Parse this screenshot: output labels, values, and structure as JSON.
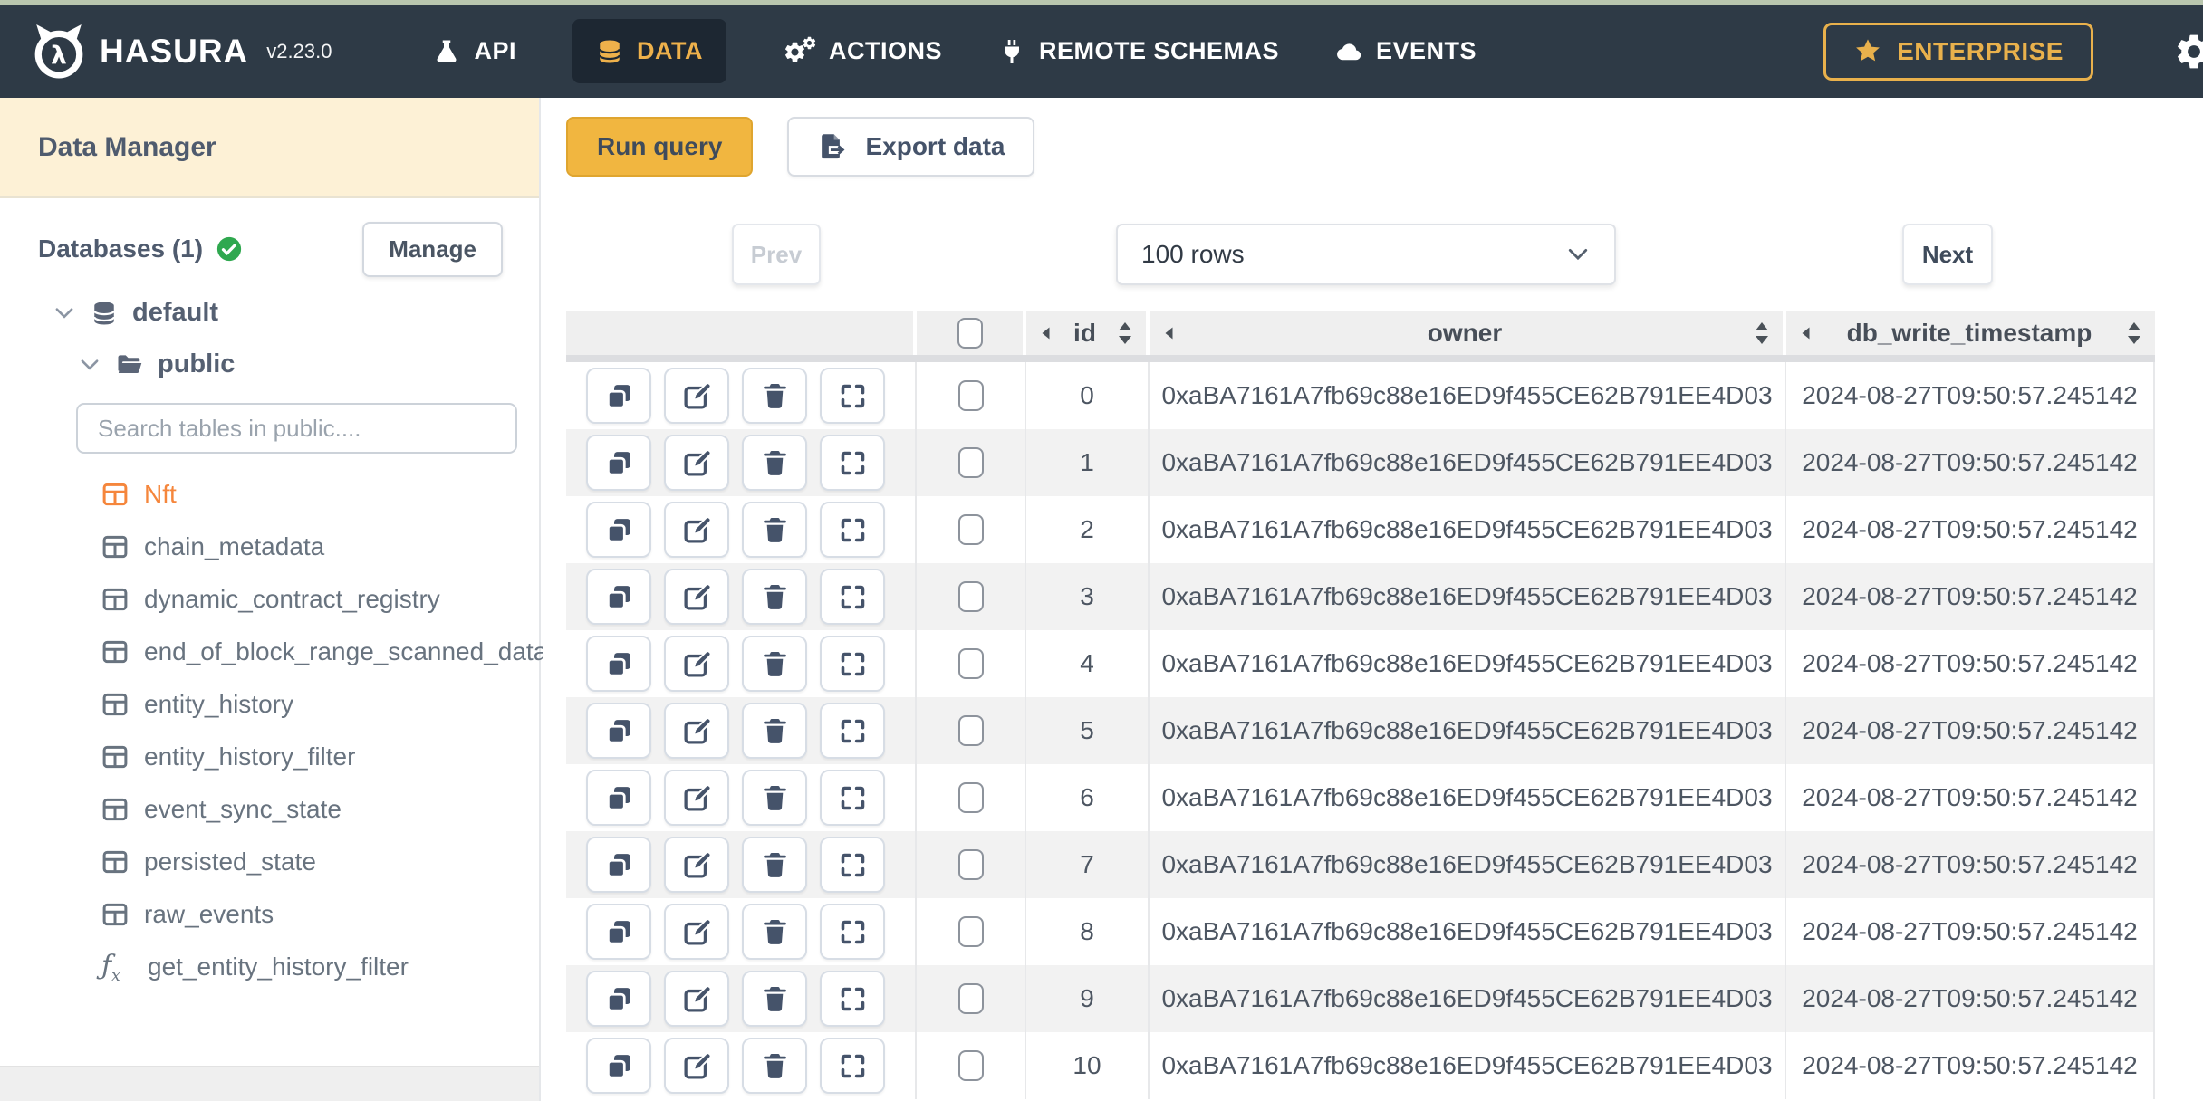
{
  "topbar": {
    "brand": "HASURA",
    "version": "v2.23.0",
    "nav": [
      {
        "label": "API",
        "icon": "flask-icon",
        "active": false
      },
      {
        "label": "DATA",
        "icon": "database-icon",
        "active": true
      },
      {
        "label": "ACTIONS",
        "icon": "gears-icon",
        "active": false
      },
      {
        "label": "REMOTE SCHEMAS",
        "icon": "plug-icon",
        "active": false
      },
      {
        "label": "EVENTS",
        "icon": "cloud-icon",
        "active": false
      }
    ],
    "enterprise_label": "ENTERPRISE"
  },
  "sidebar": {
    "title": "Data Manager",
    "databases_label": "Databases (1)",
    "manage_label": "Manage",
    "tree": {
      "database": "default",
      "schema": "public"
    },
    "search_placeholder": "Search tables in public....",
    "tables": [
      {
        "name": "Nft",
        "type": "table",
        "active": true
      },
      {
        "name": "chain_metadata",
        "type": "table",
        "active": false
      },
      {
        "name": "dynamic_contract_registry",
        "type": "table",
        "active": false
      },
      {
        "name": "end_of_block_range_scanned_data",
        "type": "table",
        "active": false
      },
      {
        "name": "entity_history",
        "type": "table",
        "active": false
      },
      {
        "name": "entity_history_filter",
        "type": "table",
        "active": false
      },
      {
        "name": "event_sync_state",
        "type": "table",
        "active": false
      },
      {
        "name": "persisted_state",
        "type": "table",
        "active": false
      },
      {
        "name": "raw_events",
        "type": "table",
        "active": false
      },
      {
        "name": "get_entity_history_filter",
        "type": "function",
        "active": false
      }
    ]
  },
  "toolbar": {
    "run_query_label": "Run query",
    "export_data_label": "Export data"
  },
  "pagination": {
    "prev_label": "Prev",
    "rows_per_page": "100 rows",
    "next_label": "Next"
  },
  "table": {
    "columns": [
      "id",
      "owner",
      "db_write_timestamp"
    ],
    "rows": [
      {
        "id": "0",
        "owner": "0xaBA7161A7fb69c88e16ED9f455CE62B791EE4D03",
        "db_write_timestamp": "2024-08-27T09:50:57.245142"
      },
      {
        "id": "1",
        "owner": "0xaBA7161A7fb69c88e16ED9f455CE62B791EE4D03",
        "db_write_timestamp": "2024-08-27T09:50:57.245142"
      },
      {
        "id": "2",
        "owner": "0xaBA7161A7fb69c88e16ED9f455CE62B791EE4D03",
        "db_write_timestamp": "2024-08-27T09:50:57.245142"
      },
      {
        "id": "3",
        "owner": "0xaBA7161A7fb69c88e16ED9f455CE62B791EE4D03",
        "db_write_timestamp": "2024-08-27T09:50:57.245142"
      },
      {
        "id": "4",
        "owner": "0xaBA7161A7fb69c88e16ED9f455CE62B791EE4D03",
        "db_write_timestamp": "2024-08-27T09:50:57.245142"
      },
      {
        "id": "5",
        "owner": "0xaBA7161A7fb69c88e16ED9f455CE62B791EE4D03",
        "db_write_timestamp": "2024-08-27T09:50:57.245142"
      },
      {
        "id": "6",
        "owner": "0xaBA7161A7fb69c88e16ED9f455CE62B791EE4D03",
        "db_write_timestamp": "2024-08-27T09:50:57.245142"
      },
      {
        "id": "7",
        "owner": "0xaBA7161A7fb69c88e16ED9f455CE62B791EE4D03",
        "db_write_timestamp": "2024-08-27T09:50:57.245142"
      },
      {
        "id": "8",
        "owner": "0xaBA7161A7fb69c88e16ED9f455CE62B791EE4D03",
        "db_write_timestamp": "2024-08-27T09:50:57.245142"
      },
      {
        "id": "9",
        "owner": "0xaBA7161A7fb69c88e16ED9f455CE62B791EE4D03",
        "db_write_timestamp": "2024-08-27T09:50:57.245142"
      },
      {
        "id": "10",
        "owner": "0xaBA7161A7fb69c88e16ED9f455CE62B791EE4D03",
        "db_write_timestamp": "2024-08-27T09:50:57.245142"
      }
    ]
  },
  "colors": {
    "nav_bg": "#2e3a46",
    "nav_active_bg": "#1d2732",
    "accent_gold": "#e9b14c",
    "run_query_bg": "#f1b640",
    "active_table_orange": "#f5863c",
    "cream_header_bg": "#fdf1d6",
    "top_strip_sage": "#b9c6ae",
    "row_stripe": "#f2f2f2",
    "success_green": "#2fa84f"
  }
}
